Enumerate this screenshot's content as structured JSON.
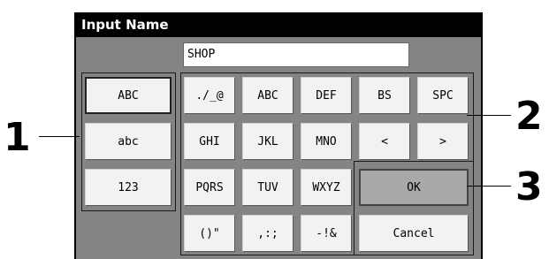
{
  "dialog": {
    "title": "Input Name"
  },
  "name_field": {
    "value": "SHOP"
  },
  "mode_keys": [
    {
      "label": "ABC"
    },
    {
      "label": "abc"
    },
    {
      "label": "123"
    }
  ],
  "char_keys": {
    "row1": [
      {
        "label": "./_@"
      },
      {
        "label": "ABC"
      },
      {
        "label": "DEF"
      },
      {
        "label": "BS"
      },
      {
        "label": "SPC"
      }
    ],
    "row2": [
      {
        "label": "GHI"
      },
      {
        "label": "JKL"
      },
      {
        "label": "MNO"
      },
      {
        "label": "<"
      },
      {
        "label": ">"
      }
    ],
    "row3": [
      {
        "label": "PQRS"
      },
      {
        "label": "TUV"
      },
      {
        "label": "WXYZ"
      }
    ],
    "row4": [
      {
        "label": "()\""
      },
      {
        "label": ",:;"
      },
      {
        "label": "-!&"
      }
    ]
  },
  "action_keys": {
    "ok": "OK",
    "cancel": "Cancel"
  },
  "callouts": {
    "c1": "1",
    "c2": "2",
    "c3": "3"
  }
}
